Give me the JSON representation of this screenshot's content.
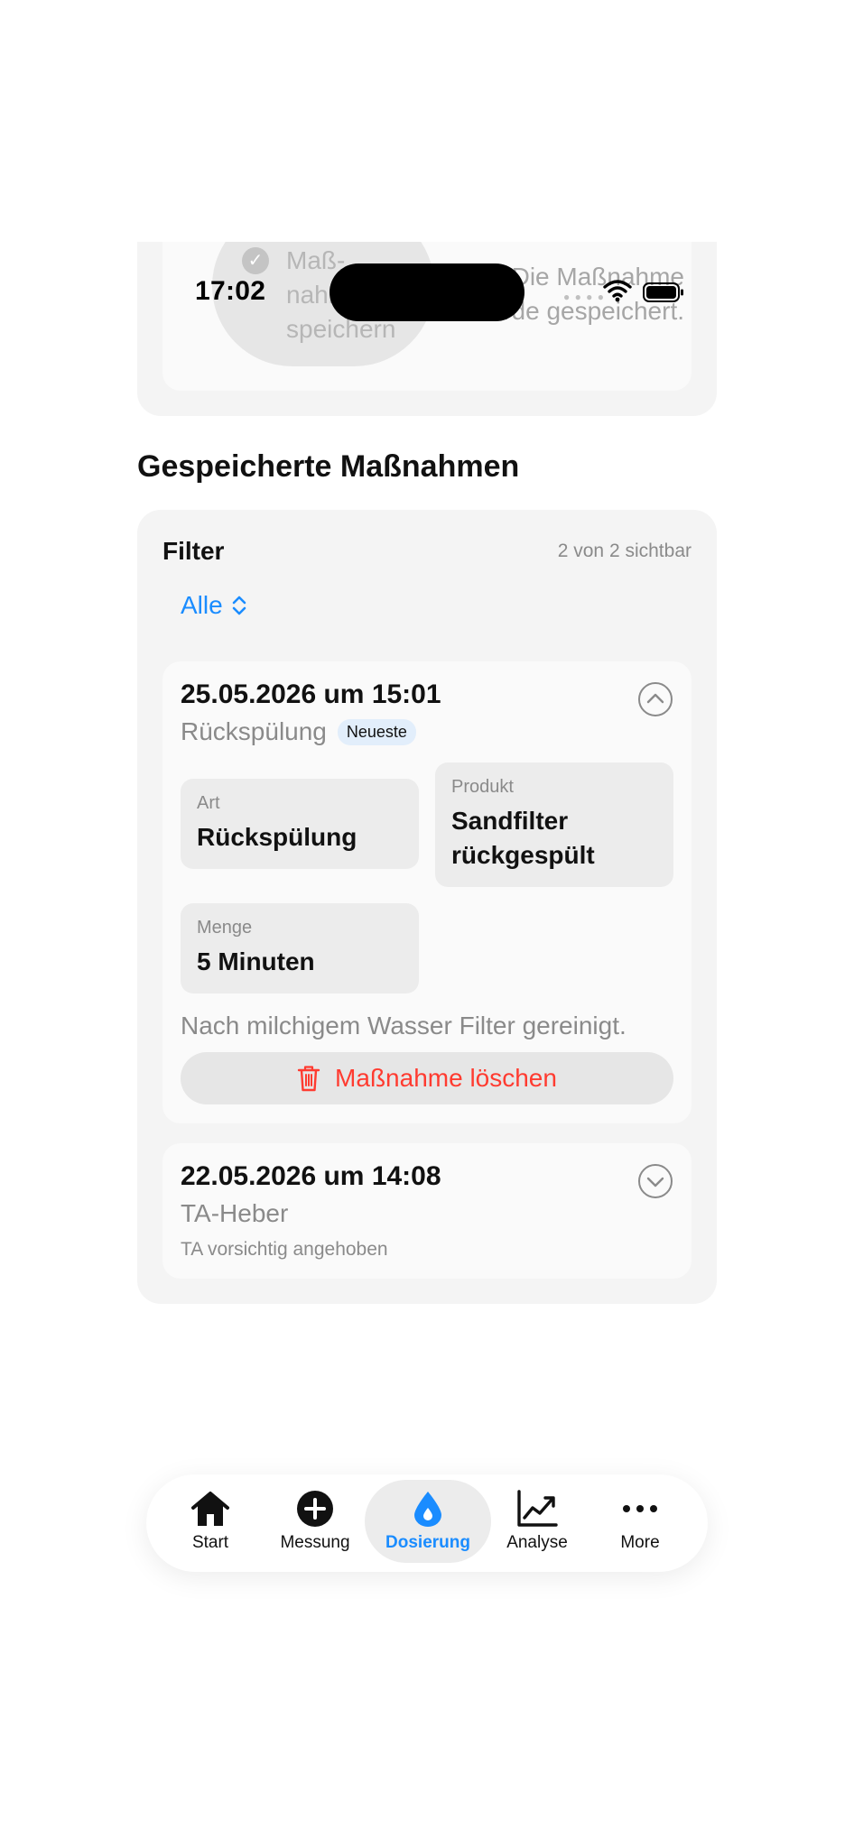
{
  "status_bar": {
    "time": "17:02"
  },
  "previous_card": {
    "save_button_label": "Maß-\nnahme\nspeichern",
    "saved_message": "Die Maßnahme wurde gespeichert."
  },
  "section_title": "Gespeicherte Maßnahmen",
  "filter": {
    "label": "Filter",
    "count": "2 von 2 sichtbar",
    "selected": "Alle"
  },
  "entries": [
    {
      "date": "25.05.2026 um 15:01",
      "type": "Rückspülung",
      "badge": "Neueste",
      "art_label": "Art",
      "art_value": "Rückspülung",
      "produkt_label": "Produkt",
      "produkt_value": "Sandfilter rückgespült",
      "menge_label": "Menge",
      "menge_value": "5 Minuten",
      "note": "Nach milchigem Wasser Filter gereinigt.",
      "delete_label": "Maßnahme löschen"
    },
    {
      "date": "22.05.2026 um 14:08",
      "type": "TA-Heber",
      "note": "TA vorsichtig angehoben"
    }
  ],
  "tabbar": {
    "tabs": [
      {
        "label": "Start",
        "icon": "house-icon"
      },
      {
        "label": "Messung",
        "icon": "plus-circle-icon"
      },
      {
        "label": "Dosierung",
        "icon": "drop-icon",
        "active": true
      },
      {
        "label": "Analyse",
        "icon": "chart-icon"
      },
      {
        "label": "More",
        "icon": "ellipsis-icon"
      }
    ]
  },
  "colors": {
    "accent": "#1a8cff",
    "danger": "#ff3b30",
    "card": "#f4f4f4"
  }
}
